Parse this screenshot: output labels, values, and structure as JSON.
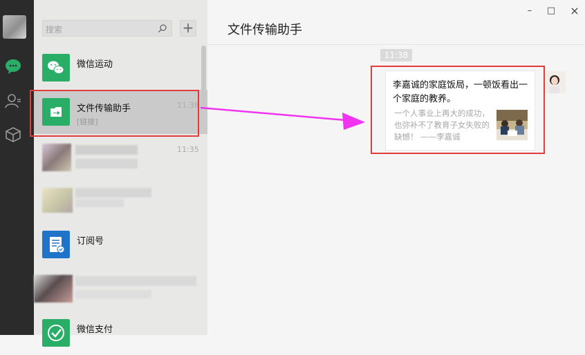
{
  "nav": {
    "icons": [
      "avatar",
      "chat-icon",
      "contacts-icon",
      "collection-icon"
    ]
  },
  "search": {
    "placeholder": "搜索"
  },
  "chat_list": [
    {
      "name": "微信运动",
      "subtitle": "",
      "time": ""
    },
    {
      "name": "文件传输助手",
      "subtitle": "[链接]",
      "time": "11:38"
    },
    {
      "name": "",
      "subtitle": "",
      "time": "11:35"
    },
    {
      "name": "",
      "subtitle": "",
      "time": ""
    },
    {
      "name": "订阅号",
      "subtitle": "",
      "time": ""
    },
    {
      "name": "",
      "subtitle": "",
      "time": ""
    },
    {
      "name": "微信支付",
      "subtitle": "",
      "time": ""
    }
  ],
  "conversation": {
    "title": "文件传输助手",
    "time_tag": "11:38",
    "message": {
      "title": "李嘉诚的家庭饭局，一顿饭看出一个家庭的教养。",
      "description": "一个人事业上再大的成功，也弥补不了教育子女失败的缺憾！ ——李嘉诚"
    }
  },
  "window_controls": {
    "minimize": "–",
    "maximize": "□",
    "close": "×"
  },
  "colors": {
    "wechat_green": "#2aae67",
    "annotation_red": "#e53a3a",
    "arrow_magenta": "#f033f0",
    "subscription_blue": "#1f73c9"
  }
}
